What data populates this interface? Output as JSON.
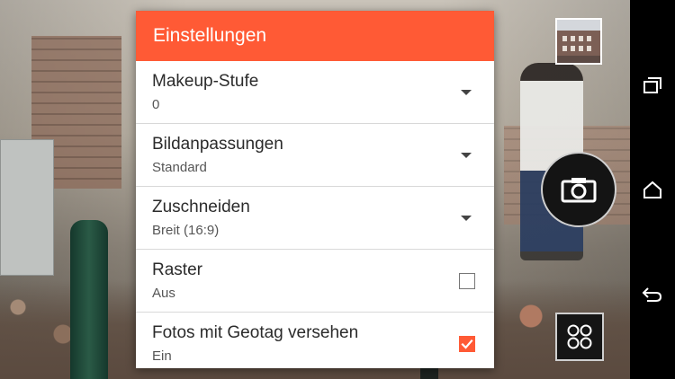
{
  "dialog": {
    "title": "Einstellungen",
    "settings": [
      {
        "title": "Makeup-Stufe",
        "value": "0",
        "control": "dropdown"
      },
      {
        "title": "Bildanpassungen",
        "value": "Standard",
        "control": "dropdown"
      },
      {
        "title": "Zuschneiden",
        "value": "Breit (16:9)",
        "control": "dropdown"
      },
      {
        "title": "Raster",
        "value": "Aus",
        "control": "checkbox",
        "checked": false
      },
      {
        "title": "Fotos mit Geotag versehen",
        "value": "Ein",
        "control": "checkbox",
        "checked": true
      }
    ]
  },
  "colors": {
    "accent": "#ff5a35",
    "navbar": "#000000"
  },
  "camera_controls": {
    "gallery_thumbnail": "gallery-thumbnail",
    "shutter_icon": "camera-icon",
    "mode_icon": "four-circles-grid-icon"
  },
  "navbar": {
    "icons": [
      "recent-apps-icon",
      "home-icon",
      "back-icon"
    ]
  }
}
